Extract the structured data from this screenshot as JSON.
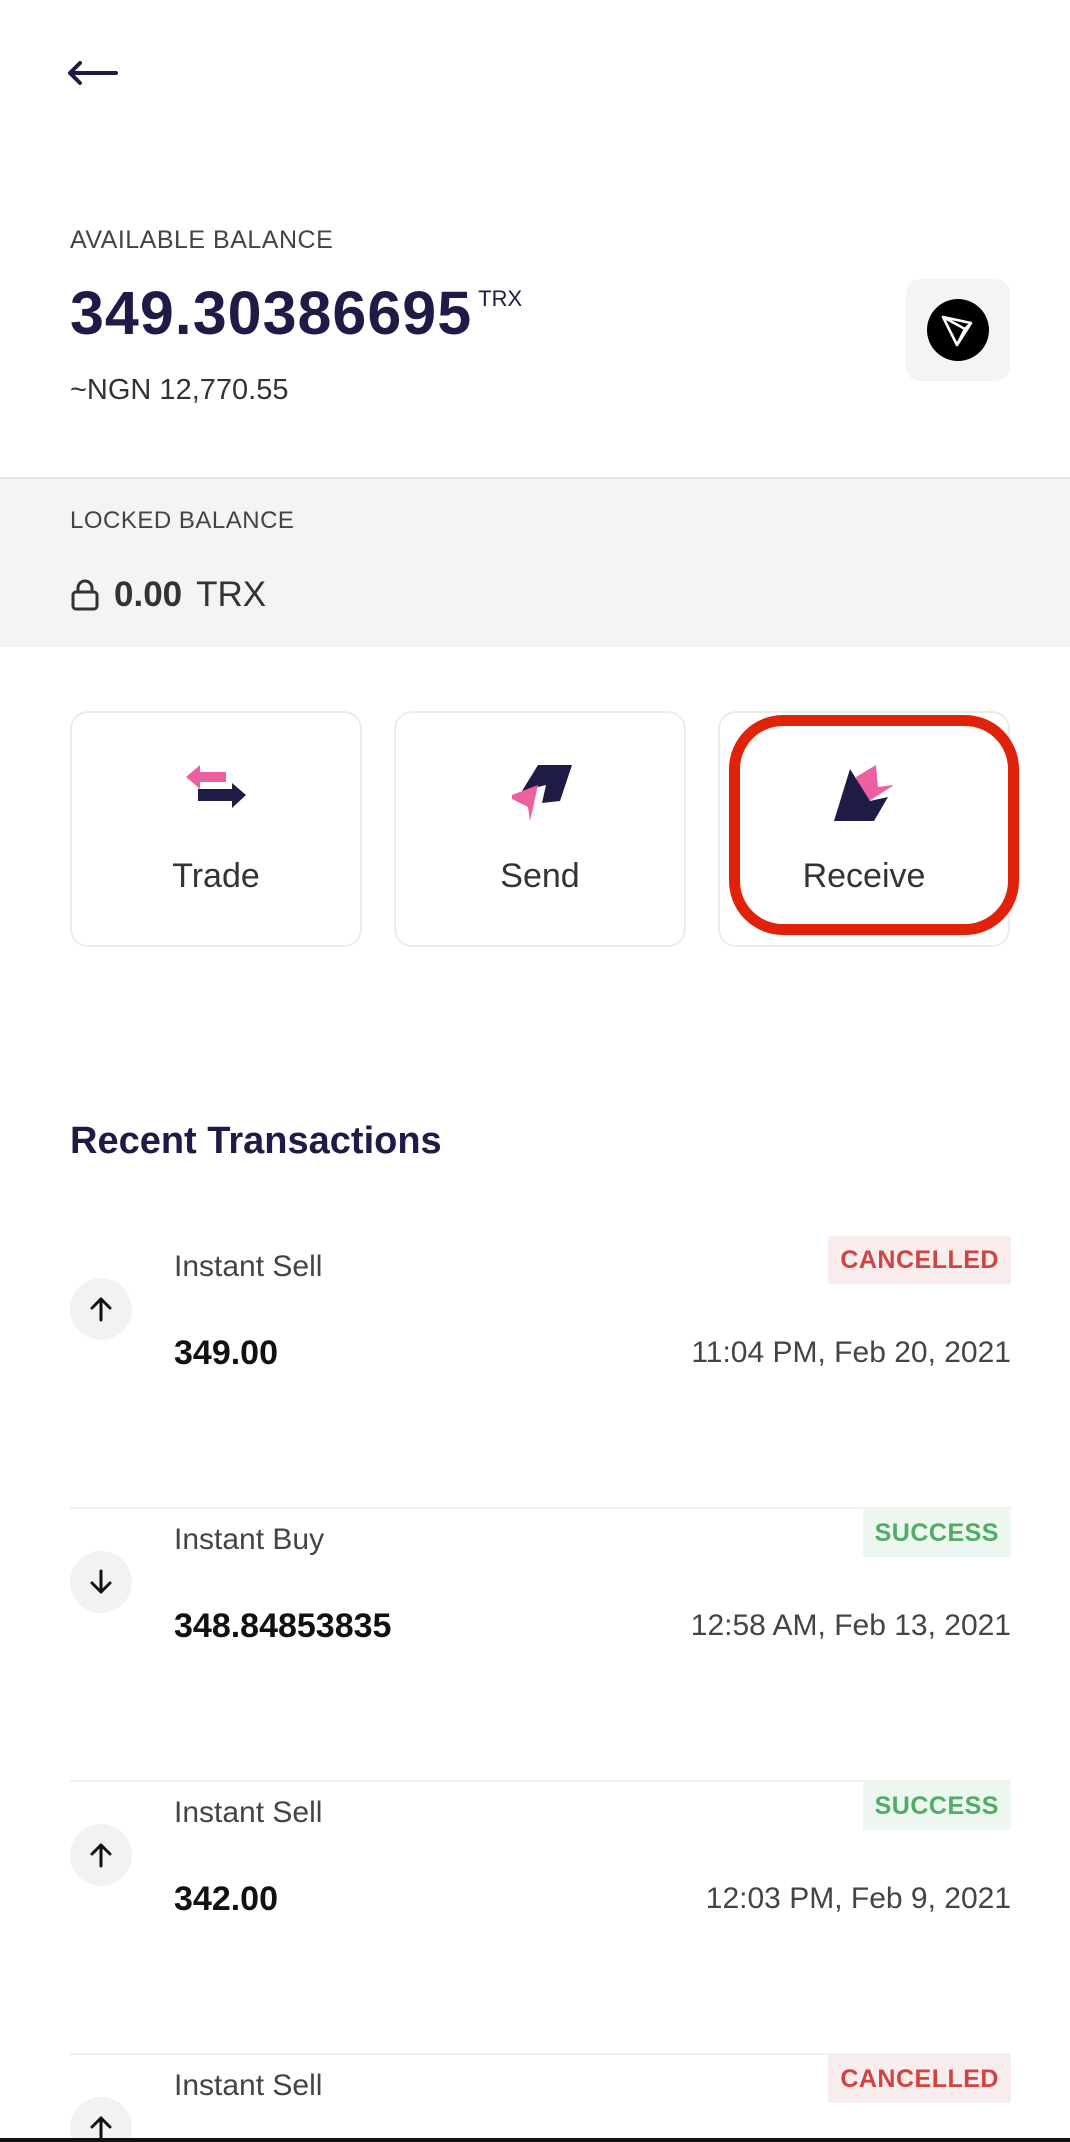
{
  "header": {
    "back_icon": "arrow-left-icon"
  },
  "balance": {
    "label": "AVAILABLE BALANCE",
    "amount": "349.30386695",
    "unit": "TRX",
    "fiat": "~NGN 12,770.55",
    "coin_icon": "tron-logo-icon"
  },
  "locked": {
    "label": "LOCKED BALANCE",
    "amount": "0.00",
    "unit": "TRX",
    "icon": "lock-icon"
  },
  "actions": [
    {
      "label": "Trade",
      "icon": "trade-icon"
    },
    {
      "label": "Send",
      "icon": "send-icon"
    },
    {
      "label": "Receive",
      "icon": "receive-icon"
    }
  ],
  "colors": {
    "brand": "#1f1b47",
    "accent_pink": "#ee5fa0",
    "highlight": "#e0220a",
    "cancelled": "#d14343",
    "success": "#4fad66"
  },
  "transactions": {
    "title": "Recent Transactions",
    "items": [
      {
        "type": "Instant Sell",
        "amount": "349.00",
        "status": "CANCELLED",
        "time": "11:04 PM, Feb 20, 2021",
        "direction": "up"
      },
      {
        "type": "Instant Buy",
        "amount": "348.84853835",
        "status": "SUCCESS",
        "time": "12:58 AM, Feb 13, 2021",
        "direction": "down"
      },
      {
        "type": "Instant Sell",
        "amount": "342.00",
        "status": "SUCCESS",
        "time": "12:03 PM, Feb 9, 2021",
        "direction": "up"
      },
      {
        "type": "Instant Sell",
        "status": "CANCELLED",
        "direction": "up"
      }
    ]
  }
}
